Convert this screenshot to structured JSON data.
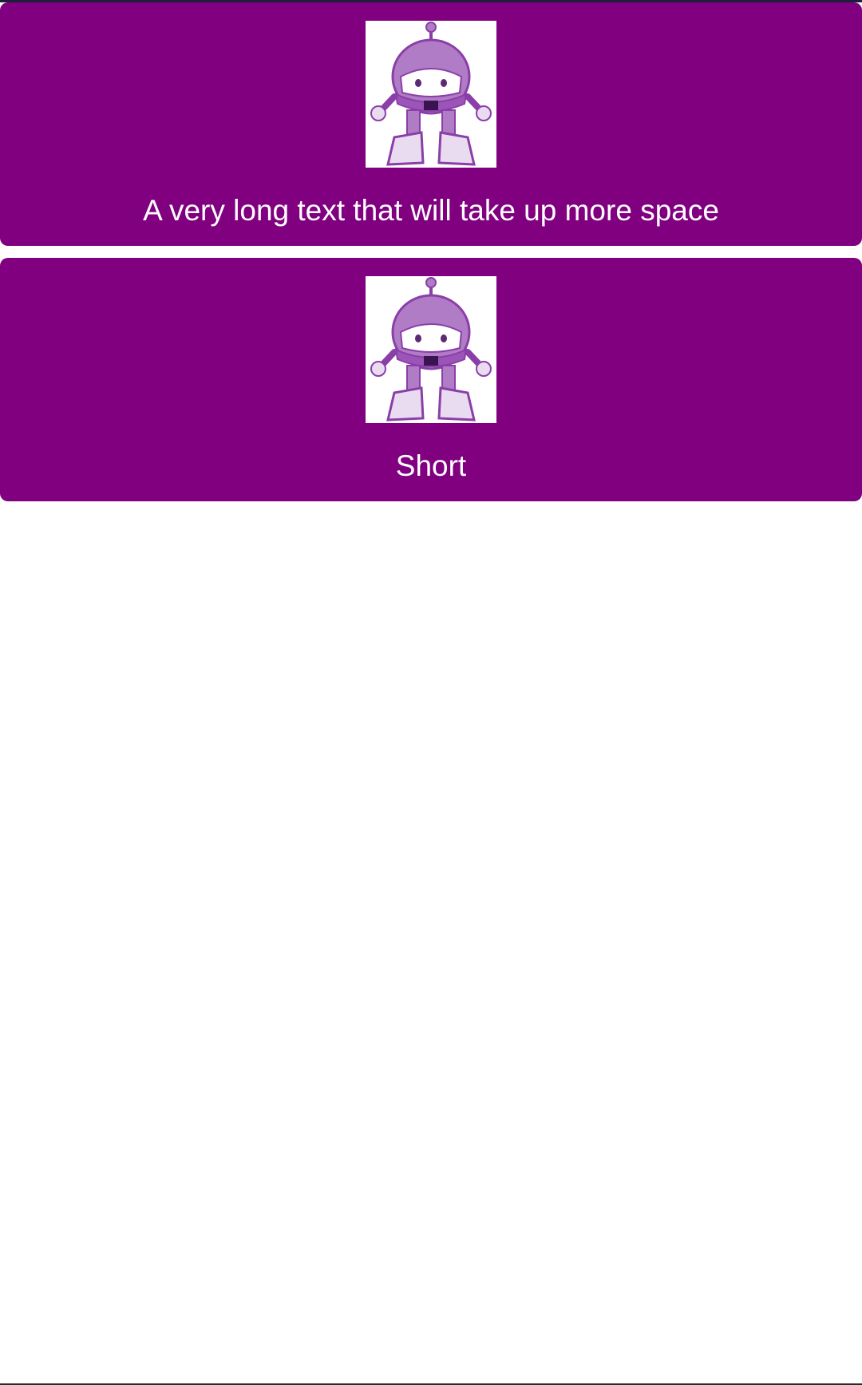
{
  "colors": {
    "card_background": "#800080",
    "card_text": "#ffffff",
    "robot_fill": "#b07cc6",
    "robot_dark": "#8a3fa8",
    "robot_light": "#e9dcf0",
    "top_bar": "#1b1f3b"
  },
  "cards": [
    {
      "image": "robot-mascot-icon",
      "label": "A very long text that will take up more space"
    },
    {
      "image": "robot-mascot-icon",
      "label": "Short"
    }
  ]
}
